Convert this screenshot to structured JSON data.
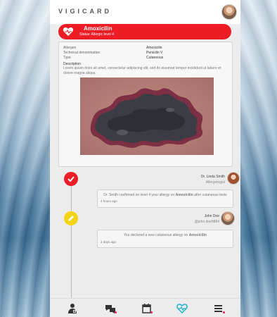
{
  "app": {
    "title": "VIGICARD"
  },
  "alert": {
    "drug": "Amoxicilin",
    "status": "Status: Allergic level 4",
    "accent": "#ee1c25"
  },
  "details": {
    "rows": [
      {
        "label": "Allergen",
        "value": "Amoxicilin"
      },
      {
        "label": "Technical denomination",
        "value": "Penicilin V"
      },
      {
        "label": "Type",
        "value": "Cutaneous"
      }
    ],
    "description_label": "Description",
    "description_text": "Lorem ipsum dolor sit amet, consectetur adipiscing elit, sed do eiusmod tempor incididunt ut labore et dolore magna aliqua."
  },
  "timeline": [
    {
      "icon": "check-icon",
      "color": "#ee1c25",
      "author_name": "Dr. Linda Smith",
      "author_sub": "Allergologist",
      "message_pre": "Dr. Smith confirmed on level 4 your allergy on ",
      "message_drug": "Amoxicilin",
      "message_post": " after cutaneous tests",
      "time": "4 hours ago"
    },
    {
      "icon": "pencil-icon",
      "color": "#f4d312",
      "author_name": "John Doe",
      "author_sub": "@john.doe9884",
      "message_pre": "You declared a new cutaneous allergy on ",
      "message_drug": "Amoxicilin",
      "message_post": "",
      "time": "3 days ago"
    }
  ],
  "nav": [
    {
      "icon": "medical-profile-icon",
      "badge": false
    },
    {
      "icon": "chat-icon",
      "badge": true
    },
    {
      "icon": "calendar-icon",
      "badge": true
    },
    {
      "icon": "heartbeat-icon",
      "badge": false,
      "active_color": "#1fb3c9"
    },
    {
      "icon": "menu-icon",
      "badge": true
    }
  ]
}
